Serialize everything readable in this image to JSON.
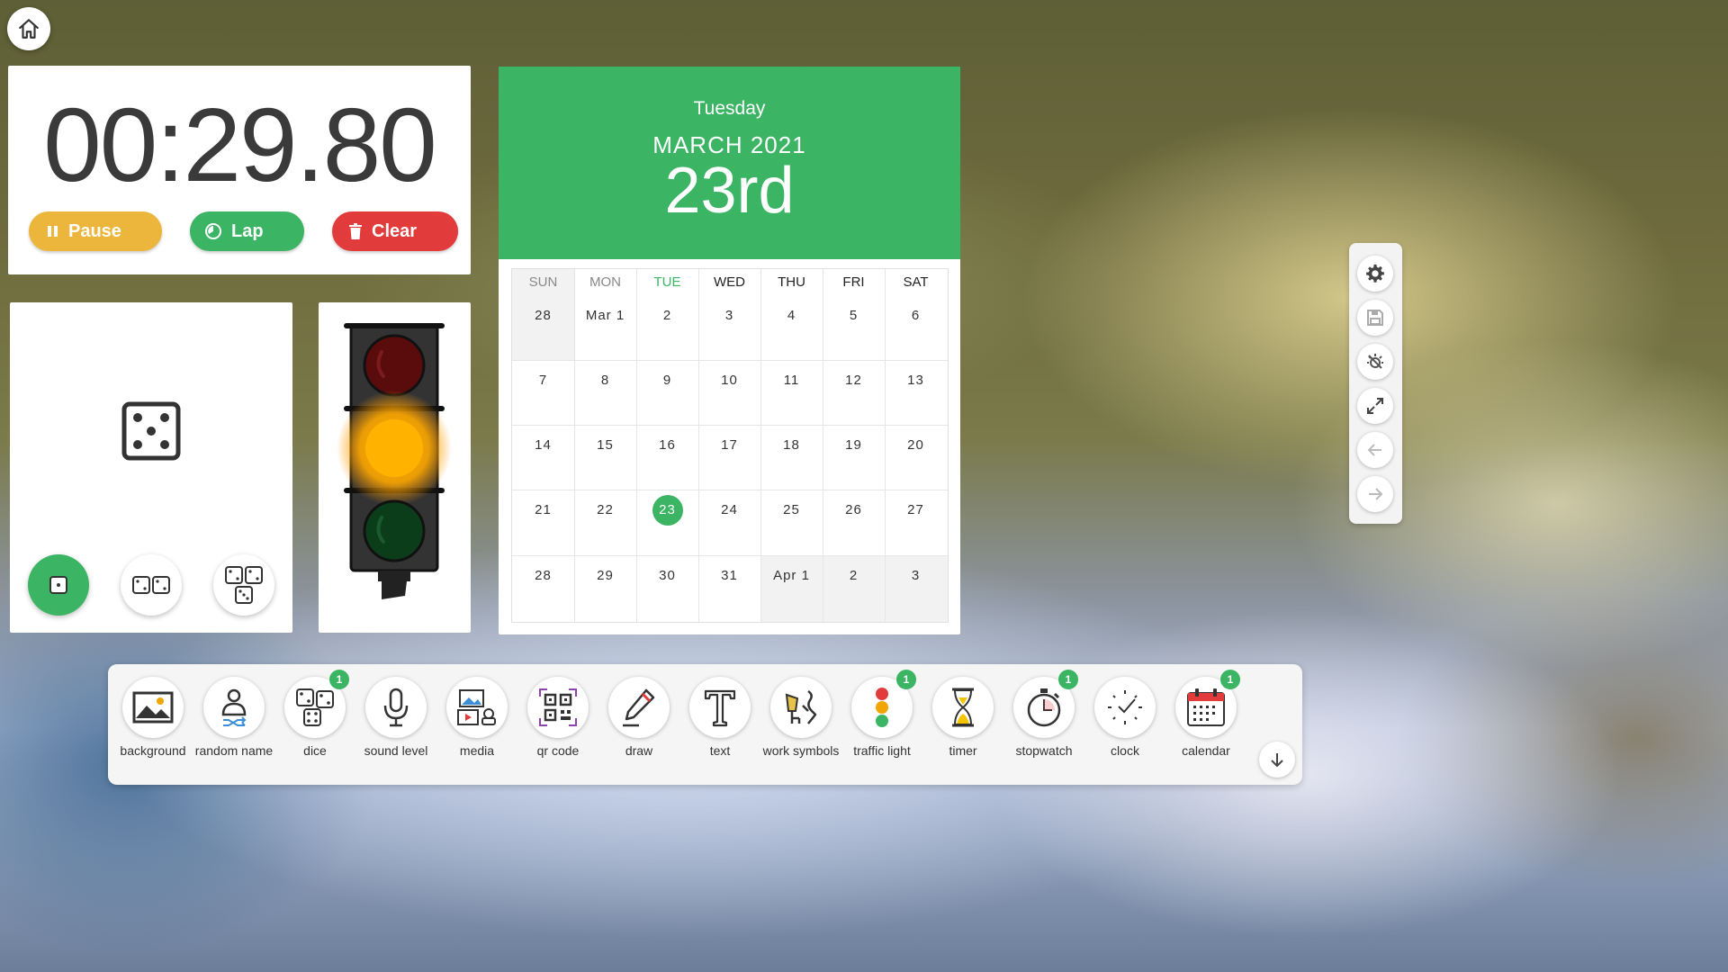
{
  "home": {
    "icon": "home-icon"
  },
  "stopwatch": {
    "time": "00:29.80",
    "buttons": {
      "pause": {
        "label": "Pause",
        "color": "#ecb53b"
      },
      "lap": {
        "label": "Lap",
        "color": "#3bb463"
      },
      "clear": {
        "label": "Clear",
        "color": "#e23b3b"
      }
    }
  },
  "dice": {
    "current_face": 5,
    "modes": [
      {
        "name": "one-die",
        "count": 1,
        "active": true
      },
      {
        "name": "two-dice",
        "count": 2,
        "active": false
      },
      {
        "name": "three-dice",
        "count": 3,
        "active": false
      }
    ]
  },
  "traffic_light": {
    "active": "amber",
    "lights": [
      "red",
      "amber",
      "green"
    ]
  },
  "calendar": {
    "weekday": "Tuesday",
    "month_year": "MARCH 2021",
    "date": "23rd",
    "accent": "#3bb463",
    "days_of_week": [
      "SUN",
      "MON",
      "TUE",
      "WED",
      "THU",
      "FRI",
      "SAT"
    ],
    "weeks": [
      [
        "28",
        "Mar 1",
        "2",
        "3",
        "4",
        "5",
        "6"
      ],
      [
        "7",
        "8",
        "9",
        "10",
        "11",
        "12",
        "13"
      ],
      [
        "14",
        "15",
        "16",
        "17",
        "18",
        "19",
        "20"
      ],
      [
        "21",
        "22",
        "23",
        "24",
        "25",
        "26",
        "27"
      ],
      [
        "28",
        "29",
        "30",
        "31",
        "Apr 1",
        "2",
        "3"
      ]
    ],
    "selected_day": "23"
  },
  "right_toolbar": [
    "gear-icon",
    "save-icon",
    "hide-widgets-icon",
    "fullscreen-icon",
    "back-arrow-icon",
    "forward-arrow-icon"
  ],
  "dock": {
    "items": [
      {
        "label": "background",
        "icon": "image-icon"
      },
      {
        "label": "random name",
        "icon": "person-shuffle-icon"
      },
      {
        "label": "dice",
        "icon": "dice-icon",
        "badge": "1"
      },
      {
        "label": "sound level",
        "icon": "microphone-icon"
      },
      {
        "label": "media",
        "icon": "media-icon"
      },
      {
        "label": "qr code",
        "icon": "qr-code-icon"
      },
      {
        "label": "draw",
        "icon": "pencil-icon"
      },
      {
        "label": "text",
        "icon": "text-icon"
      },
      {
        "label": "work symbols",
        "icon": "work-symbols-icon"
      },
      {
        "label": "traffic light",
        "icon": "traffic-light-icon",
        "badge": "1"
      },
      {
        "label": "timer",
        "icon": "hourglass-icon"
      },
      {
        "label": "stopwatch",
        "icon": "stopwatch-icon",
        "badge": "1"
      },
      {
        "label": "clock",
        "icon": "clock-icon"
      },
      {
        "label": "calendar",
        "icon": "calendar-icon",
        "badge": "1"
      }
    ]
  }
}
